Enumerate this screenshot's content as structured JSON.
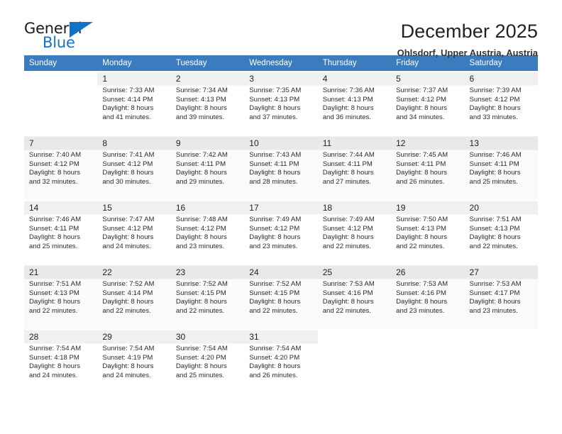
{
  "brand": {
    "name_top": "General",
    "name_bottom": "Blue",
    "accent_color": "#1273c4",
    "flag_icon": "triangle-flag-icon"
  },
  "header": {
    "title": "December 2025",
    "subtitle": "Ohlsdorf, Upper Austria, Austria"
  },
  "calendar": {
    "header_bg": "#3b7cbf",
    "weekday_headers": [
      "Sunday",
      "Monday",
      "Tuesday",
      "Wednesday",
      "Thursday",
      "Friday",
      "Saturday"
    ],
    "weeks": [
      [
        {
          "day": "",
          "lines": []
        },
        {
          "day": "1",
          "lines": [
            "Sunrise: 7:33 AM",
            "Sunset: 4:14 PM",
            "Daylight: 8 hours",
            "and 41 minutes."
          ]
        },
        {
          "day": "2",
          "lines": [
            "Sunrise: 7:34 AM",
            "Sunset: 4:13 PM",
            "Daylight: 8 hours",
            "and 39 minutes."
          ]
        },
        {
          "day": "3",
          "lines": [
            "Sunrise: 7:35 AM",
            "Sunset: 4:13 PM",
            "Daylight: 8 hours",
            "and 37 minutes."
          ]
        },
        {
          "day": "4",
          "lines": [
            "Sunrise: 7:36 AM",
            "Sunset: 4:13 PM",
            "Daylight: 8 hours",
            "and 36 minutes."
          ]
        },
        {
          "day": "5",
          "lines": [
            "Sunrise: 7:37 AM",
            "Sunset: 4:12 PM",
            "Daylight: 8 hours",
            "and 34 minutes."
          ]
        },
        {
          "day": "6",
          "lines": [
            "Sunrise: 7:39 AM",
            "Sunset: 4:12 PM",
            "Daylight: 8 hours",
            "and 33 minutes."
          ]
        }
      ],
      [
        {
          "day": "7",
          "lines": [
            "Sunrise: 7:40 AM",
            "Sunset: 4:12 PM",
            "Daylight: 8 hours",
            "and 32 minutes."
          ]
        },
        {
          "day": "8",
          "lines": [
            "Sunrise: 7:41 AM",
            "Sunset: 4:12 PM",
            "Daylight: 8 hours",
            "and 30 minutes."
          ]
        },
        {
          "day": "9",
          "lines": [
            "Sunrise: 7:42 AM",
            "Sunset: 4:11 PM",
            "Daylight: 8 hours",
            "and 29 minutes."
          ]
        },
        {
          "day": "10",
          "lines": [
            "Sunrise: 7:43 AM",
            "Sunset: 4:11 PM",
            "Daylight: 8 hours",
            "and 28 minutes."
          ]
        },
        {
          "day": "11",
          "lines": [
            "Sunrise: 7:44 AM",
            "Sunset: 4:11 PM",
            "Daylight: 8 hours",
            "and 27 minutes."
          ]
        },
        {
          "day": "12",
          "lines": [
            "Sunrise: 7:45 AM",
            "Sunset: 4:11 PM",
            "Daylight: 8 hours",
            "and 26 minutes."
          ]
        },
        {
          "day": "13",
          "lines": [
            "Sunrise: 7:46 AM",
            "Sunset: 4:11 PM",
            "Daylight: 8 hours",
            "and 25 minutes."
          ]
        }
      ],
      [
        {
          "day": "14",
          "lines": [
            "Sunrise: 7:46 AM",
            "Sunset: 4:11 PM",
            "Daylight: 8 hours",
            "and 25 minutes."
          ]
        },
        {
          "day": "15",
          "lines": [
            "Sunrise: 7:47 AM",
            "Sunset: 4:12 PM",
            "Daylight: 8 hours",
            "and 24 minutes."
          ]
        },
        {
          "day": "16",
          "lines": [
            "Sunrise: 7:48 AM",
            "Sunset: 4:12 PM",
            "Daylight: 8 hours",
            "and 23 minutes."
          ]
        },
        {
          "day": "17",
          "lines": [
            "Sunrise: 7:49 AM",
            "Sunset: 4:12 PM",
            "Daylight: 8 hours",
            "and 23 minutes."
          ]
        },
        {
          "day": "18",
          "lines": [
            "Sunrise: 7:49 AM",
            "Sunset: 4:12 PM",
            "Daylight: 8 hours",
            "and 22 minutes."
          ]
        },
        {
          "day": "19",
          "lines": [
            "Sunrise: 7:50 AM",
            "Sunset: 4:13 PM",
            "Daylight: 8 hours",
            "and 22 minutes."
          ]
        },
        {
          "day": "20",
          "lines": [
            "Sunrise: 7:51 AM",
            "Sunset: 4:13 PM",
            "Daylight: 8 hours",
            "and 22 minutes."
          ]
        }
      ],
      [
        {
          "day": "21",
          "lines": [
            "Sunrise: 7:51 AM",
            "Sunset: 4:13 PM",
            "Daylight: 8 hours",
            "and 22 minutes."
          ]
        },
        {
          "day": "22",
          "lines": [
            "Sunrise: 7:52 AM",
            "Sunset: 4:14 PM",
            "Daylight: 8 hours",
            "and 22 minutes."
          ]
        },
        {
          "day": "23",
          "lines": [
            "Sunrise: 7:52 AM",
            "Sunset: 4:15 PM",
            "Daylight: 8 hours",
            "and 22 minutes."
          ]
        },
        {
          "day": "24",
          "lines": [
            "Sunrise: 7:52 AM",
            "Sunset: 4:15 PM",
            "Daylight: 8 hours",
            "and 22 minutes."
          ]
        },
        {
          "day": "25",
          "lines": [
            "Sunrise: 7:53 AM",
            "Sunset: 4:16 PM",
            "Daylight: 8 hours",
            "and 22 minutes."
          ]
        },
        {
          "day": "26",
          "lines": [
            "Sunrise: 7:53 AM",
            "Sunset: 4:16 PM",
            "Daylight: 8 hours",
            "and 23 minutes."
          ]
        },
        {
          "day": "27",
          "lines": [
            "Sunrise: 7:53 AM",
            "Sunset: 4:17 PM",
            "Daylight: 8 hours",
            "and 23 minutes."
          ]
        }
      ],
      [
        {
          "day": "28",
          "lines": [
            "Sunrise: 7:54 AM",
            "Sunset: 4:18 PM",
            "Daylight: 8 hours",
            "and 24 minutes."
          ]
        },
        {
          "day": "29",
          "lines": [
            "Sunrise: 7:54 AM",
            "Sunset: 4:19 PM",
            "Daylight: 8 hours",
            "and 24 minutes."
          ]
        },
        {
          "day": "30",
          "lines": [
            "Sunrise: 7:54 AM",
            "Sunset: 4:20 PM",
            "Daylight: 8 hours",
            "and 25 minutes."
          ]
        },
        {
          "day": "31",
          "lines": [
            "Sunrise: 7:54 AM",
            "Sunset: 4:20 PM",
            "Daylight: 8 hours",
            "and 26 minutes."
          ]
        },
        {
          "day": "",
          "lines": []
        },
        {
          "day": "",
          "lines": []
        },
        {
          "day": "",
          "lines": []
        }
      ]
    ]
  }
}
